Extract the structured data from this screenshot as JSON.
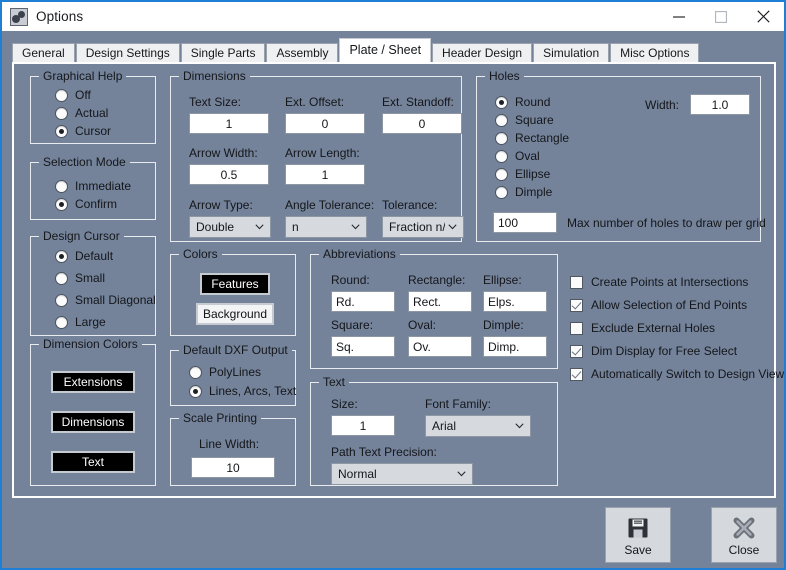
{
  "window": {
    "title": "Options",
    "icon": "app-gears-icon",
    "minimize_label": "Minimize",
    "maximize_label": "Maximize",
    "close_label": "Close"
  },
  "tabs": [
    {
      "label": "General",
      "active": false
    },
    {
      "label": "Design Settings",
      "active": false
    },
    {
      "label": "Single Parts",
      "active": false
    },
    {
      "label": "Assembly",
      "active": false
    },
    {
      "label": "Plate / Sheet",
      "active": true
    },
    {
      "label": "Header Design",
      "active": false
    },
    {
      "label": "Simulation",
      "active": false
    },
    {
      "label": "Misc Options",
      "active": false
    }
  ],
  "graphical_help": {
    "caption": "Graphical Help",
    "options": [
      {
        "label": "Off",
        "selected": false
      },
      {
        "label": "Actual",
        "selected": false
      },
      {
        "label": "Cursor",
        "selected": true
      }
    ]
  },
  "selection_mode": {
    "caption": "Selection Mode",
    "options": [
      {
        "label": "Immediate",
        "selected": false
      },
      {
        "label": "Confirm",
        "selected": true
      }
    ]
  },
  "design_cursor": {
    "caption": "Design Cursor",
    "options": [
      {
        "label": "Default",
        "selected": true
      },
      {
        "label": "Small",
        "selected": false
      },
      {
        "label": "Small Diagonal",
        "selected": false
      },
      {
        "label": "Large",
        "selected": false
      }
    ]
  },
  "dimension_colors": {
    "caption": "Dimension Colors",
    "buttons": [
      {
        "label": "Extensions",
        "style": "dark"
      },
      {
        "label": "Dimensions",
        "style": "dark"
      },
      {
        "label": "Text",
        "style": "dark"
      }
    ]
  },
  "dimensions": {
    "caption": "Dimensions",
    "text_size_label": "Text Size:",
    "text_size_value": "1",
    "ext_offset_label": "Ext. Offset:",
    "ext_offset_value": "0",
    "ext_standoff_label": "Ext. Standoff:",
    "ext_standoff_value": "0",
    "arrow_width_label": "Arrow Width:",
    "arrow_width_value": "0.5",
    "arrow_length_label": "Arrow Length:",
    "arrow_length_value": "1",
    "arrow_type_label": "Arrow Type:",
    "arrow_type_value": "Double",
    "angle_tolerance_label": "Angle Tolerance:",
    "angle_tolerance_value": "n",
    "tolerance_label": "Tolerance:",
    "tolerance_value": "Fraction n/n"
  },
  "holes": {
    "caption": "Holes",
    "options": [
      {
        "label": "Round",
        "selected": true
      },
      {
        "label": "Square",
        "selected": false
      },
      {
        "label": "Rectangle",
        "selected": false
      },
      {
        "label": "Oval",
        "selected": false
      },
      {
        "label": "Ellipse",
        "selected": false
      },
      {
        "label": "Dimple",
        "selected": false
      }
    ],
    "width_label": "Width:",
    "width_value": "1.0",
    "max_holes_value": "100",
    "max_holes_label": "Max number of holes to draw per grid"
  },
  "colors": {
    "caption": "Colors",
    "features_label": "Features",
    "background_label": "Background"
  },
  "dxf_output": {
    "caption": "Default DXF Output",
    "options": [
      {
        "label": "PolyLines",
        "selected": false
      },
      {
        "label": "Lines, Arcs, Text",
        "selected": true
      }
    ]
  },
  "scale_printing": {
    "caption": "Scale Printing",
    "line_width_label": "Line Width:",
    "line_width_value": "10"
  },
  "abbreviations": {
    "caption": "Abbreviations",
    "fields": [
      {
        "label": "Round:",
        "value": "Rd."
      },
      {
        "label": "Rectangle:",
        "value": "Rect."
      },
      {
        "label": "Ellipse:",
        "value": "Elps."
      },
      {
        "label": "Square:",
        "value": "Sq."
      },
      {
        "label": "Oval:",
        "value": "Ov."
      },
      {
        "label": "Dimple:",
        "value": "Dimp."
      }
    ]
  },
  "text": {
    "caption": "Text",
    "size_label": "Size:",
    "size_value": "1",
    "font_family_label": "Font Family:",
    "font_family_value": "Arial",
    "path_precision_label": "Path Text Precision:",
    "path_precision_value": "Normal"
  },
  "checkboxes": [
    {
      "label": "Create Points at Intersections",
      "checked": false
    },
    {
      "label": "Allow Selection of End Points",
      "checked": true
    },
    {
      "label": "Exclude External Holes",
      "checked": false
    },
    {
      "label": "Dim Display for Free Select",
      "checked": true
    },
    {
      "label": "Automatically Switch to Design View",
      "checked": true
    }
  ],
  "footer": {
    "save_label": "Save",
    "close_label": "Close"
  },
  "colors_hex": {
    "window_bg": "#74839a",
    "accent_border": "#1f7fd4",
    "titlebar_bg": "#ffffff",
    "input_bg": "#ffffff",
    "select_bg": "#d6dade",
    "button_bg": "#d5d9dd",
    "color_button_dark": "#000000"
  }
}
